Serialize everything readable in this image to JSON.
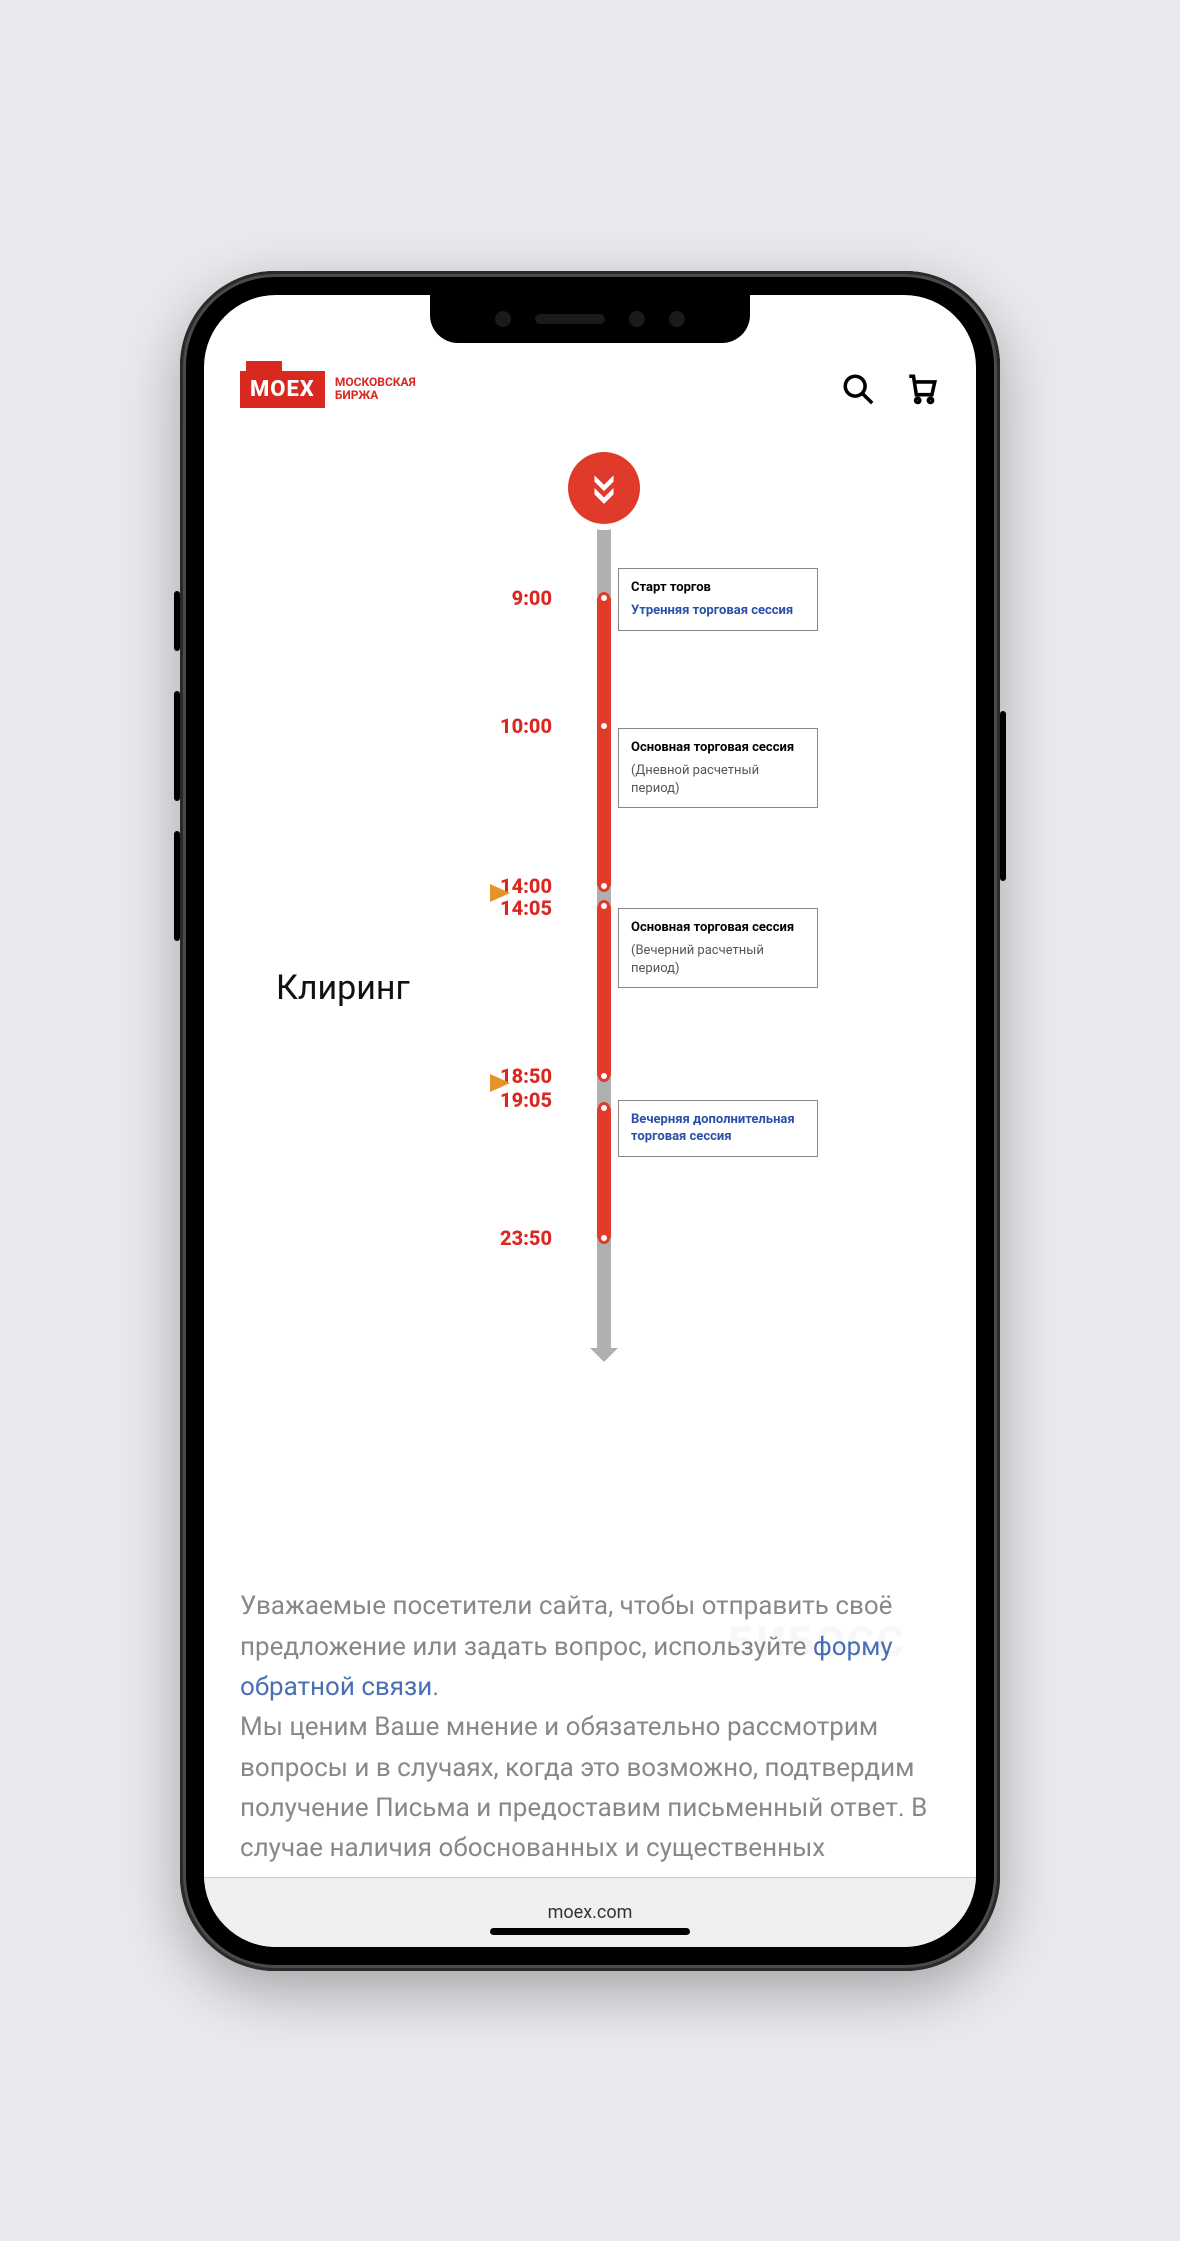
{
  "header": {
    "logo_mark": "MOEX",
    "logo_text_line1": "МОСКОВСКАЯ",
    "logo_text_line2": "БИРЖА"
  },
  "timeline": {
    "times": [
      "9:00",
      "10:00",
      "14:00",
      "14:05",
      "18:50",
      "19:05",
      "23:50"
    ],
    "cards": [
      {
        "title": "Старт торгов",
        "link": "Утренняя торговая сессия",
        "sub": ""
      },
      {
        "title": "Основная торговая сессия",
        "link": "",
        "sub": "(Дневной расчетный период)"
      },
      {
        "title": "Основная торговая сессия",
        "link": "",
        "sub": "(Вечерний расчетный период)"
      },
      {
        "title": "",
        "link": "Вечерняя дополнительная торговая сессия",
        "sub": ""
      }
    ],
    "annotation_label": "Клиринг"
  },
  "footer": {
    "line1": "Уважаемые посетители сайта, чтобы отправить своё предложение или задать вопрос, используйте ",
    "link1": "форму обратной связи",
    "period": ".",
    "line2": "Мы ценим Ваше мнение и обязательно рассмотрим вопросы и в случаях, когда это возможно, подтвердим получение Письма и предоставим письменный ответ. В случае наличия обоснованных и существенных "
  },
  "address_bar": "moex.com",
  "watermark": "БИБОСС"
}
